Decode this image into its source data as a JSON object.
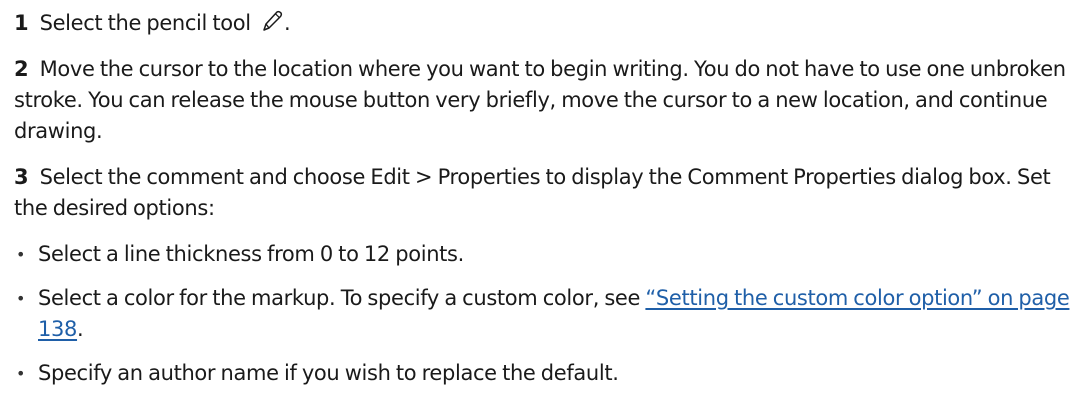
{
  "steps": [
    {
      "number": "1",
      "text": "Select the pencil tool",
      "icon": "pencil-icon",
      "trailing": "."
    },
    {
      "number": "2",
      "text": "Move the cursor to the location where you want to begin writing. You do not have to use one unbroken stroke. You can release the mouse button very briefly, move the cursor to a new location, and continue drawing."
    },
    {
      "number": "3",
      "text": "Select the comment and choose Edit > Properties to display the Comment Properties dialog box. Set the desired options:"
    }
  ],
  "bullets": [
    {
      "text": "Select a line thickness from 0 to 12 points."
    },
    {
      "text": "Select a color for the markup. To specify a custom color, see ",
      "link": "“Setting the custom color option” on page 138",
      "after": "."
    },
    {
      "text": "Specify an author name if you wish to replace the default."
    }
  ],
  "colors": {
    "link": "#1f5fa8",
    "text": "#1a1a1a"
  }
}
